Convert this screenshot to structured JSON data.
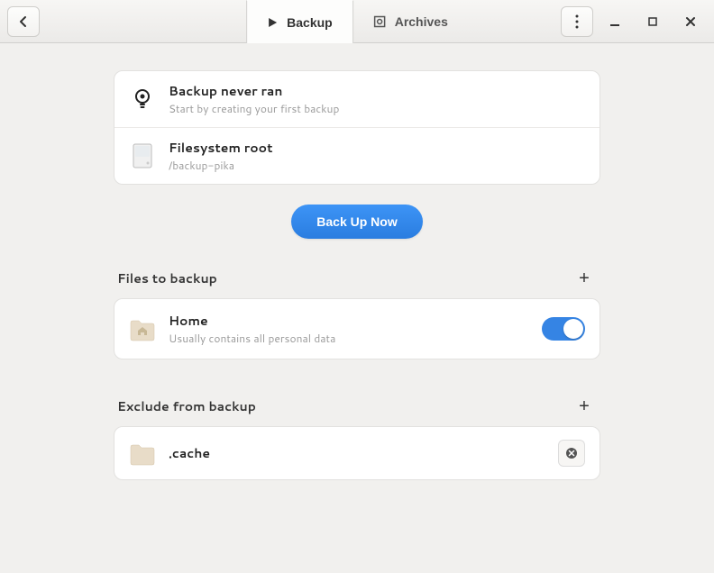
{
  "tabs": {
    "backup": "Backup",
    "archives": "Archives"
  },
  "status": {
    "title": "Backup never ran",
    "subtitle": "Start by creating your first backup"
  },
  "destination": {
    "title": "Filesystem root",
    "path": "/backup-pika"
  },
  "primary_action": "Back Up Now",
  "sections": {
    "include": "Files to backup",
    "exclude": "Exclude from backup"
  },
  "include_items": [
    {
      "title": "Home",
      "subtitle": "Usually contains all personal data",
      "enabled": true
    }
  ],
  "exclude_items": [
    {
      "title": ".cache"
    }
  ]
}
